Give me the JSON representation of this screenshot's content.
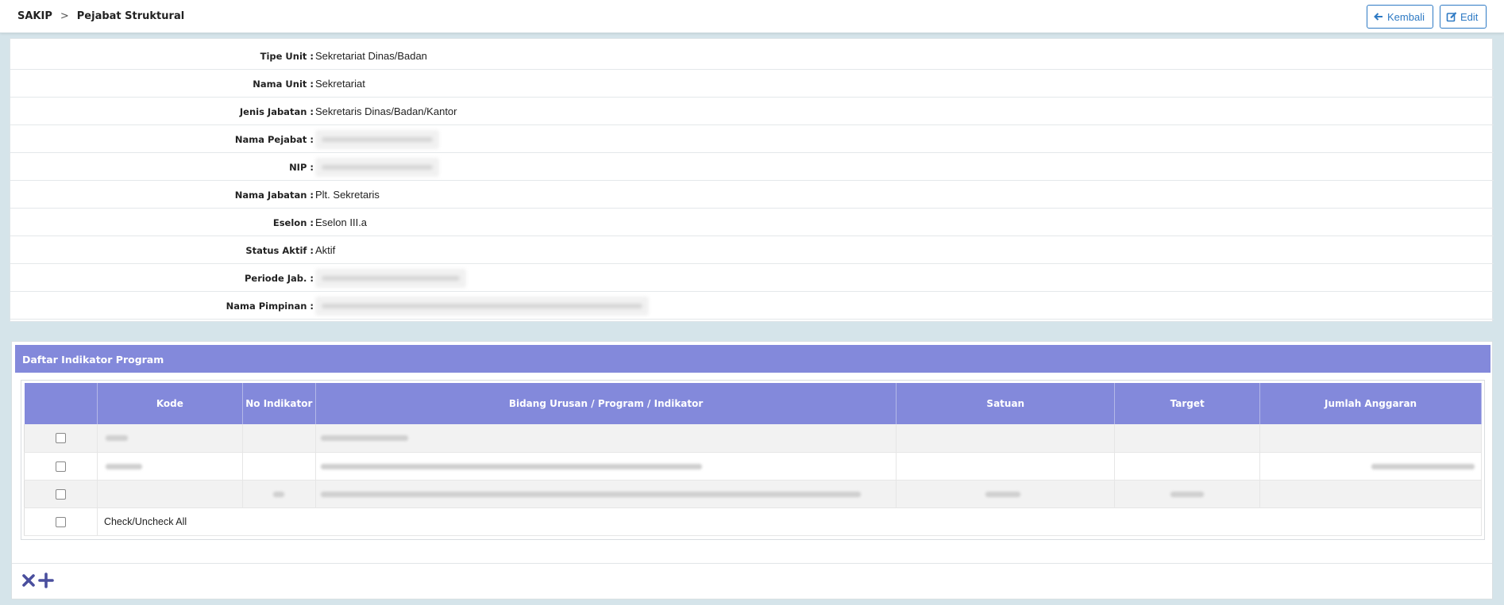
{
  "breadcrumb": {
    "root": "SAKIP",
    "separator": ">",
    "current": "Pejabat Struktural"
  },
  "toolbar": {
    "back_label": "Kembali",
    "edit_label": "Edit",
    "accent": "#2e7ac4"
  },
  "details": [
    {
      "label": "Tipe Unit :",
      "value": "Sekretariat Dinas/Badan"
    },
    {
      "label": "Nama Unit :",
      "value": "Sekretariat"
    },
    {
      "label": "Jenis Jabatan :",
      "value": "Sekretaris Dinas/Badan/Kantor"
    },
    {
      "label": "Nama Pejabat :",
      "value": null
    },
    {
      "label": "NIP :",
      "value": null
    },
    {
      "label": "Nama Jabatan :",
      "value": "Plt. Sekretaris"
    },
    {
      "label": "Eselon :",
      "value": "Eselon III.a"
    },
    {
      "label": "Status Aktif :",
      "value": "Aktif"
    },
    {
      "label": "Periode Jab. :",
      "value": null
    },
    {
      "label": "Nama Pimpinan :",
      "value": null
    }
  ],
  "panel": {
    "title": "Daftar Indikator Program",
    "header_color": "#8389db",
    "columns": [
      "",
      "Kode",
      "No Indikator",
      "Bidang Urusan / Program / Indikator",
      "Satuan",
      "Target",
      "Jumlah Anggaran"
    ],
    "check_all_label": "Check/Uncheck All"
  },
  "actions": {
    "delete_icon": "close-icon",
    "add_icon": "plus-icon"
  }
}
